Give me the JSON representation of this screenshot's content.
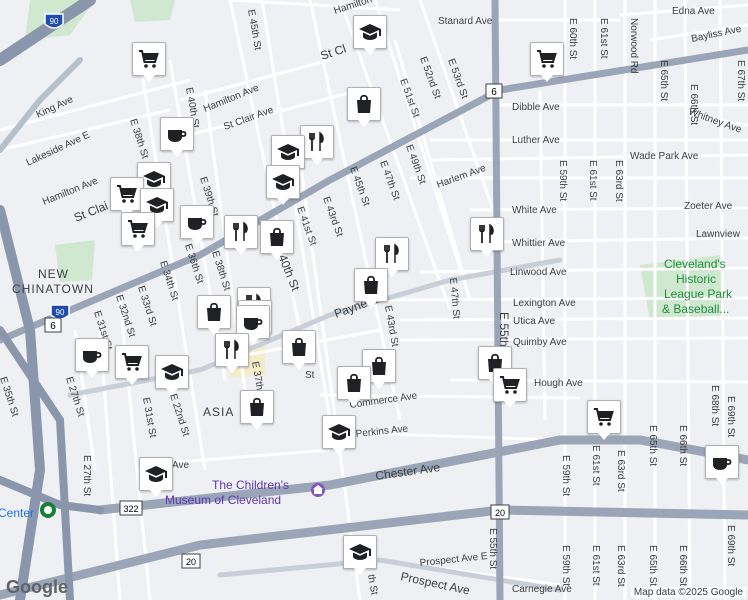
{
  "map": {
    "attribution": "Map data ©2025 Google",
    "logo": "Google",
    "neighborhoods": [
      {
        "key": "new",
        "text": "NEW"
      },
      {
        "key": "chinatown",
        "text": "CHINATOWN"
      },
      {
        "key": "asia",
        "text": "ASIA"
      },
      {
        "key": "center",
        "text": "Center"
      }
    ],
    "poi": {
      "museum_line1": "The Children's",
      "museum_line2": "Museum of Cleveland",
      "park_line1": "Cleveland's",
      "park_line2": "Historic",
      "park_line3": "League Park",
      "park_line4": "& Baseball..."
    },
    "highway_shields": [
      "90",
      "90",
      "6",
      "6",
      "322",
      "20",
      "20",
      "E 55th St"
    ],
    "street_labels": {
      "hamilton_top": "Hamilton",
      "standard": "Stanard Ave",
      "edna": "Edna Ave",
      "bayliss": "Bayliss Ave",
      "e45_top": "E 45th St",
      "st_clair_top": "St Cl",
      "e52": "E 52nd St",
      "e53": "E 53rd St",
      "e60": "E 60th St",
      "e61": "E 61st St",
      "norwood": "Norwood Rd",
      "e65": "E 65th St",
      "e66": "E 66th St",
      "e67": "E 67th St",
      "king": "King Ave",
      "e40": "E 40th St",
      "hamilton": "Hamilton Ave",
      "st_clair_mid": "St Clair Ave",
      "e51": "E 51st St",
      "dibble": "Dibble Ave",
      "whitney": "Whitney Ave",
      "lakeside": "Lakeside Ave E",
      "e38": "E 38th St",
      "luther": "Luther Ave",
      "e49": "E 49th St",
      "wade_park": "Wade Park Ave",
      "hamilton_left": "Hamilton Ave",
      "e47": "E 47th St",
      "e45": "E 45th St",
      "e43": "E 43rd St",
      "harlem": "Harlem Ave",
      "e59": "E 59th St",
      "e61b": "E 61st St",
      "e63": "E 63rd St",
      "st_clair_left": "St Clai",
      "e39": "E 39th St",
      "e41": "E 41st St",
      "white": "White Ave",
      "zoeter": "Zoeter Ave",
      "whittier": "Whittier Ave",
      "lawnview": "Lawnview",
      "e40b": "E 40th St",
      "linwood": "Linwood Ave",
      "e36": "E 36th St",
      "e38b": "E 38th St",
      "e34": "E 34th St",
      "lexington": "Lexington Ave",
      "e33": "E 33rd St",
      "e32": "E 32nd St",
      "e31": "E 31st St",
      "payne": "Payne Ave",
      "e43b": "E 43rd St",
      "e47b": "E 47th St",
      "utica": "Utica Ave",
      "quimby": "Quimby Ave",
      "e55": "E 55th St",
      "e37": "E 37th St",
      "e27": "E 27th St",
      "e35": "E 35th St",
      "e22": "E 22nd St",
      "hough": "Hough Ave",
      "commerce": "Commerce Ave",
      "perkins": "Perkins Ave",
      "e31b": "E 31st St",
      "e30": "E 30th St",
      "e59b": "E 59th St",
      "e61c": "E 61st St",
      "e63b": "E 63rd St",
      "e65b": "E 65th St",
      "e66b": "E 66th St",
      "e68": "E 68th St",
      "e69": "E 69th St",
      "chester": "Chester Ave",
      "e27b": "E 27th St",
      "e30b": "E 30th St",
      "e59c": "E 59th St",
      "e61d": "E 61st St",
      "e63c": "E 63rd St",
      "e65c": "E 65th St",
      "e66c": "E 66th St",
      "e69b": "E 69th St",
      "prospect_e": "Prospect Ave E",
      "prospect": "Prospect Ave",
      "carnegie": "Carnegie Ave",
      "e55b": "E 55th St",
      "e40c": "E 40th St",
      "ave_left": "Ave",
      "th_st": "th St",
      "st_e41": "St"
    },
    "markers": [
      {
        "type": "school",
        "icon": "school-icon"
      },
      {
        "type": "cart",
        "icon": "shopping-cart-icon"
      },
      {
        "type": "cart",
        "icon": "shopping-cart-icon"
      },
      {
        "type": "bag",
        "icon": "shopping-bag-icon"
      },
      {
        "type": "cafe",
        "icon": "coffee-cup-icon"
      },
      {
        "type": "restaurant",
        "icon": "fork-knife-icon"
      },
      {
        "type": "school",
        "icon": "school-icon"
      },
      {
        "type": "school",
        "icon": "school-icon"
      },
      {
        "type": "cart",
        "icon": "shopping-cart-icon"
      },
      {
        "type": "school",
        "icon": "school-icon"
      },
      {
        "type": "school",
        "icon": "school-icon"
      },
      {
        "type": "cafe",
        "icon": "coffee-cup-icon"
      },
      {
        "type": "cart",
        "icon": "shopping-cart-icon"
      },
      {
        "type": "restaurant",
        "icon": "fork-knife-icon"
      },
      {
        "type": "bag",
        "icon": "shopping-bag-icon"
      },
      {
        "type": "restaurant",
        "icon": "fork-knife-icon"
      },
      {
        "type": "restaurant",
        "icon": "fork-knife-icon"
      },
      {
        "type": "bag",
        "icon": "shopping-bag-icon"
      },
      {
        "type": "restaurant",
        "icon": "fork-knife-icon"
      },
      {
        "type": "bag",
        "icon": "shopping-bag-icon"
      },
      {
        "type": "cafe",
        "icon": "coffee-cup-icon"
      },
      {
        "type": "cafe",
        "icon": "coffee-cup-icon"
      },
      {
        "type": "cafe",
        "icon": "coffee-cup-icon"
      },
      {
        "type": "cart",
        "icon": "shopping-cart-icon"
      },
      {
        "type": "school",
        "icon": "school-icon"
      },
      {
        "type": "restaurant",
        "icon": "fork-knife-icon"
      },
      {
        "type": "bag",
        "icon": "shopping-bag-icon"
      },
      {
        "type": "bag",
        "icon": "shopping-bag-icon"
      },
      {
        "type": "bag",
        "icon": "shopping-bag-icon"
      },
      {
        "type": "bag",
        "icon": "shopping-bag-icon"
      },
      {
        "type": "school",
        "icon": "school-icon"
      },
      {
        "type": "bag",
        "icon": "shopping-bag-icon"
      },
      {
        "type": "cart",
        "icon": "shopping-cart-icon"
      },
      {
        "type": "cart",
        "icon": "shopping-cart-icon"
      },
      {
        "type": "school",
        "icon": "school-icon"
      },
      {
        "type": "school",
        "icon": "school-icon"
      },
      {
        "type": "cafe",
        "icon": "coffee-cup-icon"
      }
    ]
  }
}
